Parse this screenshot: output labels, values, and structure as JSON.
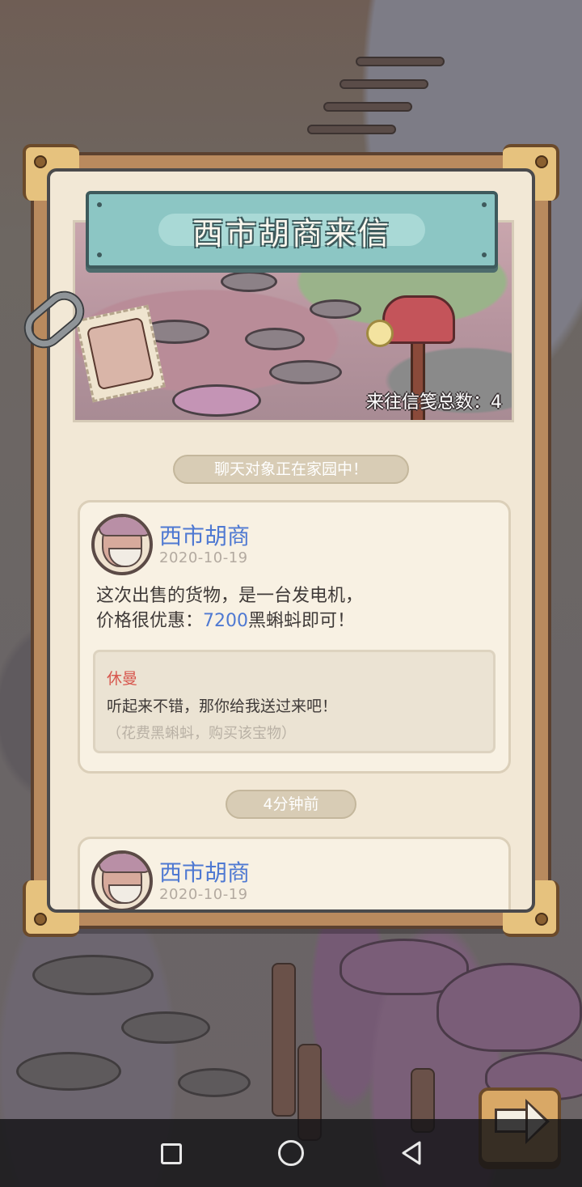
{
  "letter": {
    "title": "西市胡商来信",
    "total_count_label": "来往信笺总数：4",
    "status_pill": "聊天对象正在家园中！",
    "messages": [
      {
        "sender": "西市胡商",
        "date": "2020-10-19",
        "text_line1": "这次出售的货物，是一台发电机，",
        "text_line2_prefix": "价格很优惠：",
        "price": "7200",
        "text_line2_suffix": "黑蝌蚪即可！",
        "reply": {
          "name": "休曼",
          "text": "听起来不错，那你给我送过来吧！",
          "hint": "（花费黑蝌蚪，购买该宝物）"
        }
      },
      {
        "sender": "西市胡商",
        "date": "2020-10-19"
      }
    ],
    "time_pill": "4分钟前"
  },
  "icons": {
    "next": "arrow-right-icon",
    "chain": "chain-link-icon",
    "stamp": "stamp-portrait-icon",
    "mailbox": "mailbox-icon"
  },
  "navbar": {
    "recent": "square-icon",
    "home": "circle-icon",
    "back": "triangle-back-icon"
  },
  "colors": {
    "accent_blue": "#4f79d2",
    "reply_name_red": "#d7574e",
    "banner_teal": "#8cc6c4",
    "frame_wood": "#b98a5e"
  }
}
